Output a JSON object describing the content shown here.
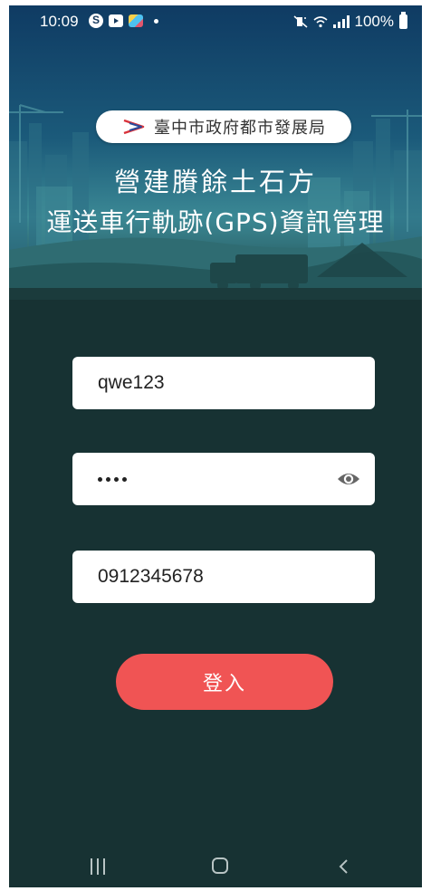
{
  "status_bar": {
    "time": "10:09",
    "battery_text": "100%",
    "icons_left": [
      "skype-icon",
      "youtube-icon",
      "gallery-icon",
      "dot"
    ],
    "icons_right": [
      "mute-vibrate-icon",
      "wifi-icon",
      "signal-icon",
      "battery-icon"
    ]
  },
  "header": {
    "agency_name": "臺中市政府都市發展局",
    "title_line1": "營建賸餘土石方",
    "title_line2": "運送車行軌跡(GPS)資訊管理"
  },
  "form": {
    "username_value": "qwe123",
    "password_mask_length": 4,
    "phone_value": "0912345678",
    "login_label": "登入"
  },
  "navbar": {
    "buttons": [
      "recent-apps",
      "home",
      "back"
    ]
  },
  "colors": {
    "background": "#173233",
    "button": "#f05454",
    "header_top": "#0f3b63"
  }
}
